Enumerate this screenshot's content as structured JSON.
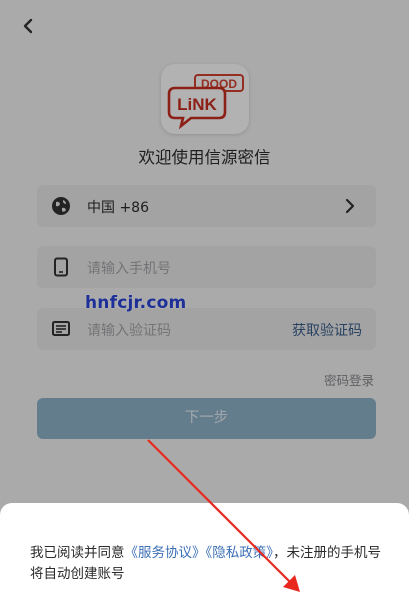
{
  "header": {
    "back_icon": "chevron-left-icon"
  },
  "app": {
    "logo_text_top": "DOOD",
    "logo_text_main": "LiNK",
    "welcome": "欢迎使用信源密信"
  },
  "form": {
    "country": {
      "label": "中国 +86",
      "icon": "globe-icon"
    },
    "phone": {
      "placeholder": "请输入手机号",
      "icon": "phone-icon"
    },
    "code": {
      "placeholder": "请输入验证码",
      "get_code": "获取验证码",
      "icon": "message-icon"
    },
    "password_login": "密码登录",
    "next_button": "下一步"
  },
  "sheet": {
    "text_before": "我已阅读并同意",
    "service_agreement": "《服务协议》",
    "privacy_policy": "《隐私政策》",
    "text_after": "，未注册的手机号将自动创建账号"
  },
  "watermark": "hnfcjr.com",
  "colors": {
    "accent_link": "#3b6fb6",
    "next_button": "#8fb3c9",
    "arrow": "#e8271f",
    "watermark": "#2c46d8"
  }
}
